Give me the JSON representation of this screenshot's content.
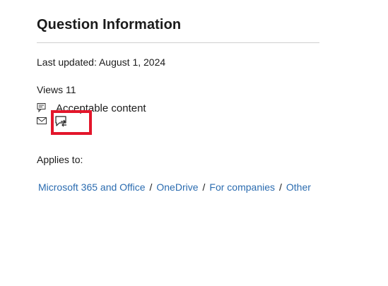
{
  "header": {
    "title": "Question Information"
  },
  "meta": {
    "last_updated": "Last updated: August 1, 2024",
    "views": "Views 11"
  },
  "actions": {
    "acceptable_content_label": "Acceptable content",
    "icons": [
      "report-icon",
      "mail-icon",
      "feedback-icon"
    ],
    "highlight_color": "#e3162b"
  },
  "applies_to": {
    "label": "Applies to:",
    "items": [
      "Microsoft 365 and Office",
      "OneDrive",
      "For companies",
      "Other"
    ],
    "separator": "/",
    "link_color": "#2b6cb0"
  }
}
